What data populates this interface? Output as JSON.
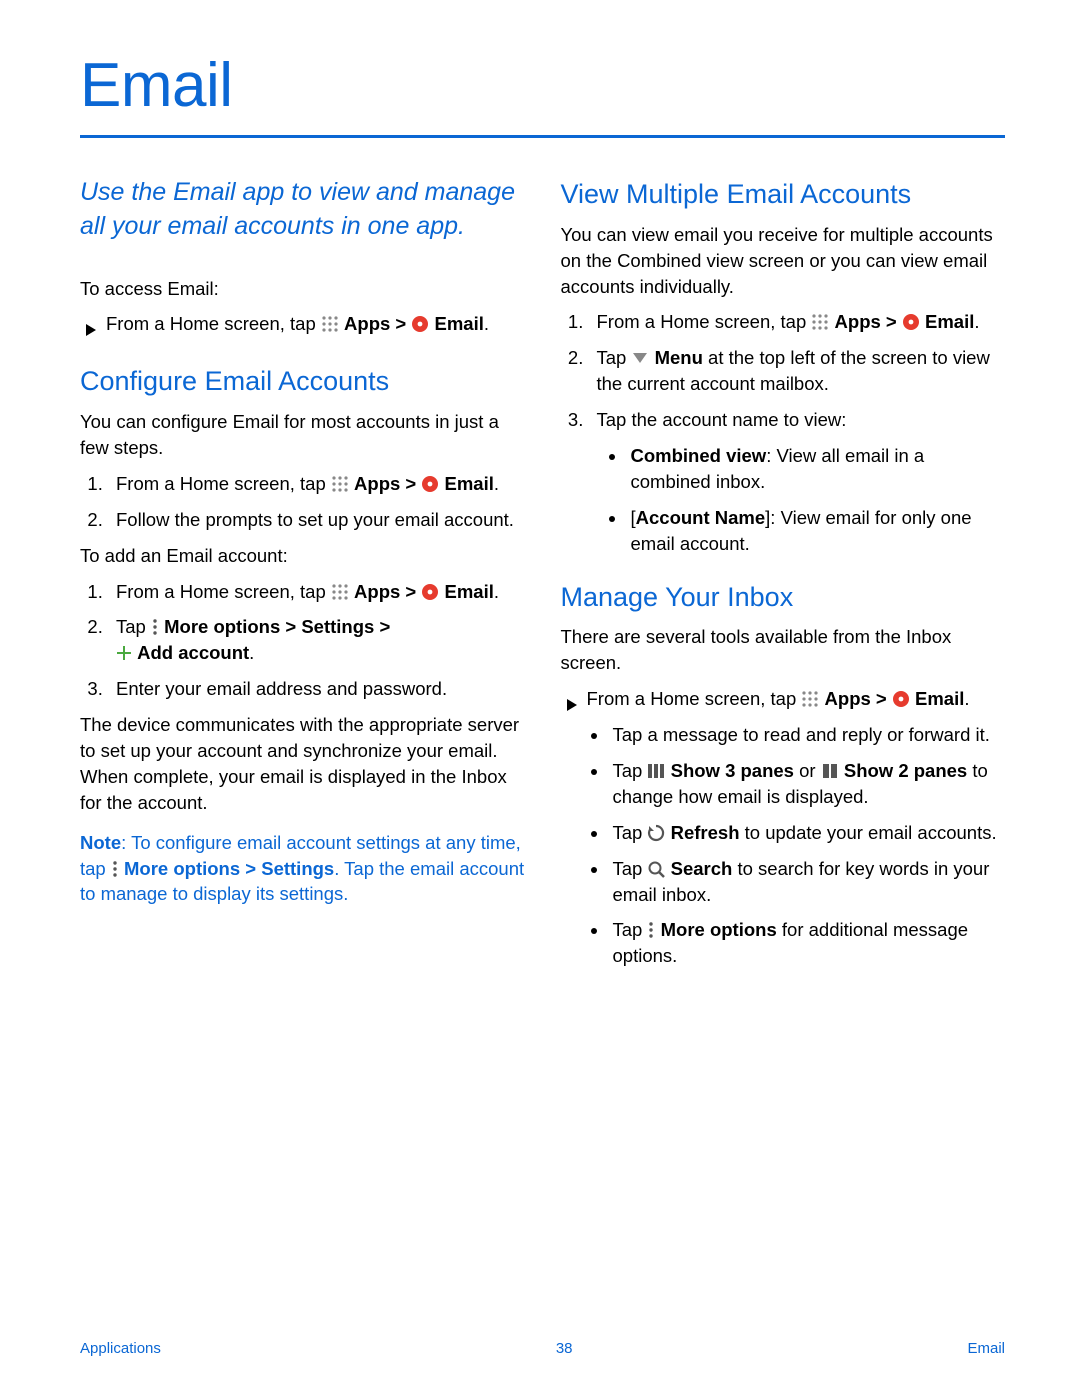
{
  "title": "Email",
  "intro": "Use the Email app to view and manage all your email accounts in one app.",
  "left": {
    "access_label": "To access Email:",
    "access_step_pre": "From a Home screen, tap ",
    "apps_label": "Apps",
    "gt": " > ",
    "email_label": "Email",
    "period": ".",
    "h_configure": "Configure Email Accounts",
    "configure_intro": "You can configure Email for most accounts in just a few steps.",
    "cfg1_pre": "From a Home screen, tap ",
    "cfg2": "Follow the prompts to set up your email account.",
    "add_label": "To add an Email account:",
    "add1_pre": "From a Home screen, tap ",
    "add2_pre": "Tap ",
    "more_options": "More options",
    "settings": "Settings",
    "add_account": "Add account",
    "add3": "Enter your email address and password.",
    "sync_para": "The device communicates with the appropriate server to set up your account and synchronize your email. When complete, your email is displayed in the Inbox for the account.",
    "note_label": "Note",
    "note_a": ": To configure email account settings at any time, tap ",
    "note_b": ". Tap the email account to manage to display its settings."
  },
  "right": {
    "h_view": "View Multiple Email Accounts",
    "view_intro": "You can view email you receive for multiple accounts on the Combined view screen or you can view email accounts individually.",
    "v1_pre": "From a Home screen, tap ",
    "v2_pre": "Tap ",
    "menu_label": "Menu",
    "v2_post": " at the top left of the screen to view the current account mailbox.",
    "v3": "Tap the account name to view:",
    "v3a_b": "Combined view",
    "v3a": ": View all email in a combined inbox.",
    "v3b_b": "Account Name",
    "v3b": "]: View email for only one email account.",
    "v3b_open": "[",
    "h_manage": "Manage Your Inbox",
    "manage_intro": "There are several tools available from the Inbox screen.",
    "m_arrow_pre": "From a Home screen, tap ",
    "m_b1": "Tap a message to read and reply or forward it.",
    "m_b2_pre": "Tap ",
    "show3": "Show 3 panes",
    "or": " or ",
    "show2": "Show 2 panes",
    "m_b2_post": " to change how email is displayed.",
    "m_b3_pre": "Tap ",
    "refresh": "Refresh",
    "m_b3_post": " to update your email accounts.",
    "m_b4_pre": "Tap ",
    "search": "Search",
    "m_b4_post": " to search for key words in your email inbox.",
    "m_b5_pre": "Tap ",
    "m_b5_post": " for additional message options."
  },
  "footer": {
    "left": "Applications",
    "center": "38",
    "right": "Email"
  }
}
